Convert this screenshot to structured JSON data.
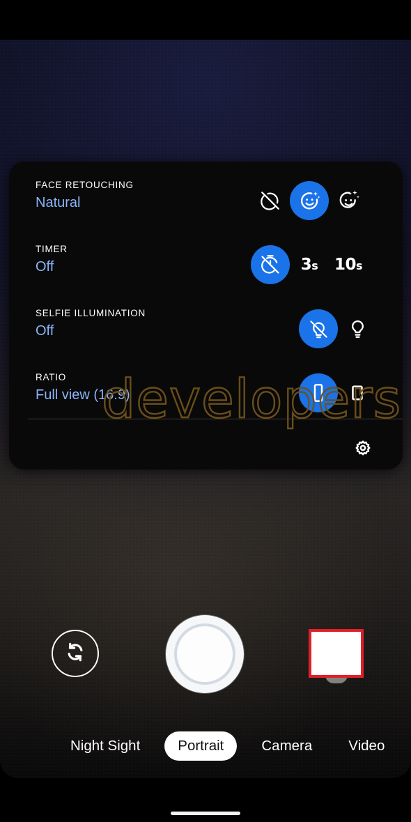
{
  "app": {
    "name": "Camera",
    "mode_active": "Portrait"
  },
  "watermark": {
    "text": "developers"
  },
  "settings_panel": {
    "rows": [
      {
        "id": "face-retouching",
        "label": "FACE RETOUCHING",
        "value": "Natural",
        "options": [
          {
            "id": "face-retouching-off",
            "icon": "face-retouch-off-icon",
            "selected": false
          },
          {
            "id": "face-retouching-natural",
            "icon": "face-retouch-natural-icon",
            "selected": true
          },
          {
            "id": "face-retouching-enhanced",
            "icon": "face-retouch-enhanced-icon",
            "selected": false
          }
        ]
      },
      {
        "id": "timer",
        "label": "TIMER",
        "value": "Off",
        "options": [
          {
            "id": "timer-off",
            "icon": "timer-off-icon",
            "selected": true
          },
          {
            "id": "timer-3s",
            "icon": "text",
            "text": "3",
            "unit": "s",
            "selected": false
          },
          {
            "id": "timer-10s",
            "icon": "text",
            "text": "10",
            "unit": "s",
            "selected": false
          }
        ]
      },
      {
        "id": "selfie-illumination",
        "label": "SELFIE ILLUMINATION",
        "value": "Off",
        "options": [
          {
            "id": "selfie-illumination-off",
            "icon": "bulb-off-icon",
            "selected": true
          },
          {
            "id": "selfie-illumination-on",
            "icon": "bulb-on-icon",
            "selected": false
          }
        ]
      },
      {
        "id": "ratio",
        "label": "RATIO",
        "value": "Full view (16:9)",
        "options": [
          {
            "id": "ratio-full-view",
            "icon": "ratio-16-9-icon",
            "selected": true
          },
          {
            "id": "ratio-4-3",
            "icon": "ratio-4-3-icon",
            "selected": false
          }
        ]
      }
    ],
    "more_settings": {
      "id": "more-settings",
      "icon": "gear-icon"
    }
  },
  "bottom_controls": {
    "flip_camera": {
      "icon": "flip-camera-icon"
    },
    "shutter": {
      "icon": "shutter-button"
    },
    "thumbnail": {
      "icon": "gallery-thumbnail",
      "border_color": "#e01f26"
    }
  },
  "mode_selector": {
    "modes": [
      {
        "id": "night-sight",
        "label": "Night Sight",
        "active": false
      },
      {
        "id": "portrait",
        "label": "Portrait",
        "active": true
      },
      {
        "id": "camera",
        "label": "Camera",
        "active": false
      },
      {
        "id": "video",
        "label": "Video",
        "active": false
      }
    ]
  },
  "colors": {
    "accent_blue": "#1a73e8",
    "value_blue": "#8ab4f8",
    "panel_bg": "#090909",
    "thumbnail_red": "#e01f26",
    "watermark_brown": "#6e511a"
  }
}
